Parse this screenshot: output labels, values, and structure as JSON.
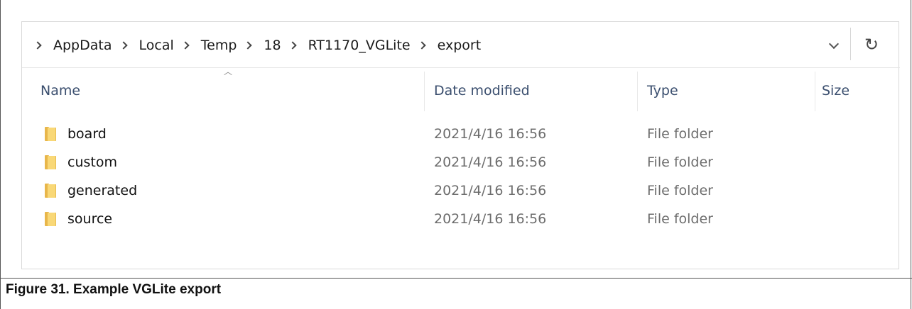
{
  "explorer": {
    "breadcrumb": [
      "AppData",
      "Local",
      "Temp",
      "18",
      "RT1170_VGLite",
      "export"
    ],
    "columns": {
      "name": "Name",
      "date": "Date modified",
      "type": "Type",
      "size": "Size"
    },
    "rows": [
      {
        "name": "board",
        "date": "2021/4/16 16:56",
        "type": "File folder"
      },
      {
        "name": "custom",
        "date": "2021/4/16 16:56",
        "type": "File folder"
      },
      {
        "name": "generated",
        "date": "2021/4/16 16:56",
        "type": "File folder"
      },
      {
        "name": "source",
        "date": "2021/4/16 16:56",
        "type": "File folder"
      }
    ],
    "refresh_glyph": "↻",
    "sort_glyph": "︿"
  },
  "caption": "Figure 31. Example VGLite export"
}
